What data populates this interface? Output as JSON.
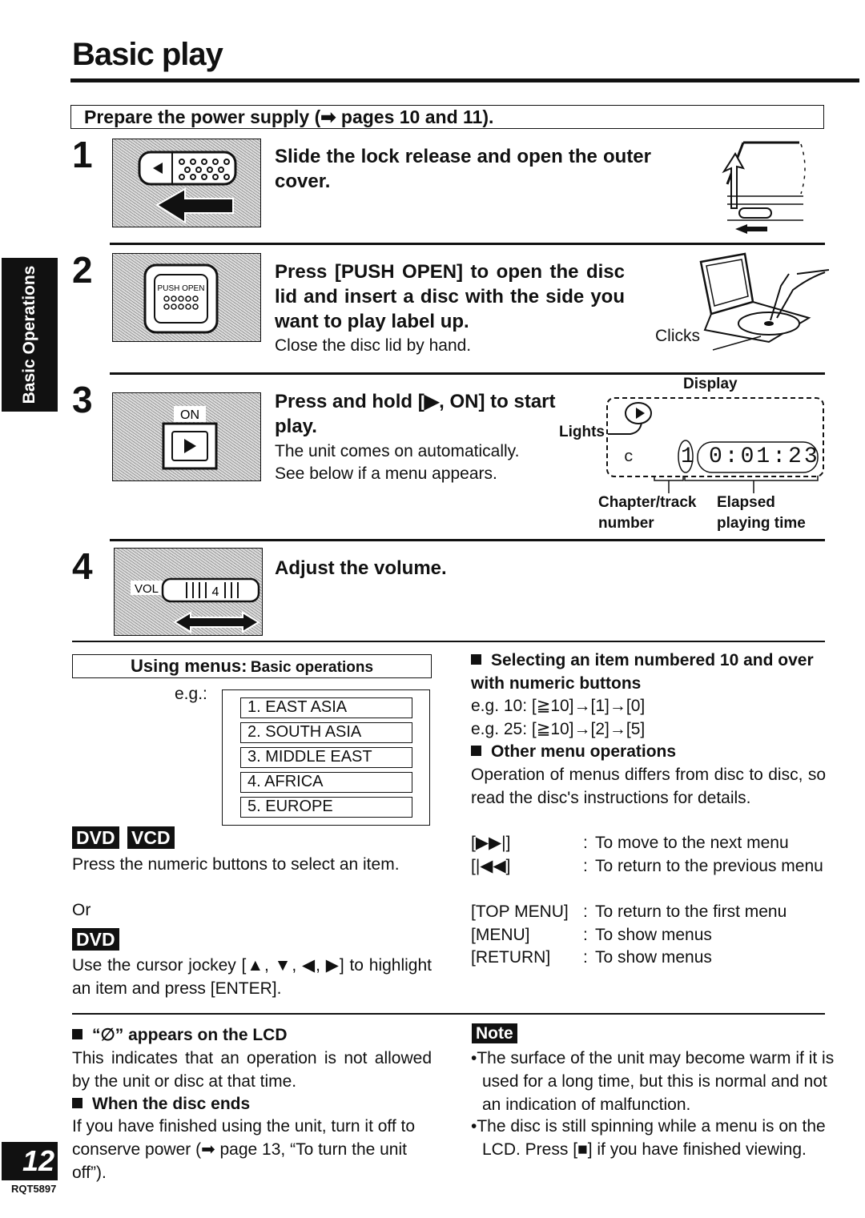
{
  "page": {
    "title": "Basic play",
    "side_tab": "Basic Operations",
    "page_number": "12",
    "doc_code": "RQT5897"
  },
  "prepare": {
    "text": "Prepare the power supply (➡ pages 10 and 11)."
  },
  "steps": [
    {
      "number": "1",
      "instruction": "Slide the lock release and open the outer cover.",
      "note": "",
      "photo_icon": "lock-release-slider-icon"
    },
    {
      "number": "2",
      "instruction": "Press [PUSH OPEN] to open the disc lid and insert a disc with the side you want to play label up.",
      "note": "Close the disc lid by hand.",
      "photo_label": "PUSH OPEN",
      "callout": "Clicks"
    },
    {
      "number": "3",
      "instruction": "Press and hold [▶, ON] to start play.",
      "note_lines": [
        "The unit comes on automatically.",
        "See below if a menu appears."
      ],
      "photo_label": "ON"
    },
    {
      "number": "4",
      "instruction": "Adjust the volume.",
      "photo_label": "VOL",
      "volume_value": "4"
    }
  ],
  "display": {
    "heading": "Display",
    "lights_label": "Lights",
    "chapter_value": "1",
    "time_value": "0:01:23",
    "left_indicator": "c",
    "chapter_label_line1": "Chapter/track",
    "chapter_label_line2": "number",
    "elapsed_label_line1": "Elapsed",
    "elapsed_label_line2": "playing time"
  },
  "menus": {
    "heading_main": "Using menus:",
    "heading_sub": "Basic operations",
    "eg_label": "e.g.:",
    "example_items": [
      "1. EAST ASIA",
      "2. SOUTH ASIA",
      "3. MIDDLE EAST",
      "4. AFRICA",
      "5. EUROPE"
    ],
    "badges_top": [
      "DVD",
      "VCD"
    ],
    "numeric_text": "Press the numeric buttons to select an item.",
    "or_text": "Or",
    "badge_dvd": "DVD",
    "cursor_text": "Use the cursor jockey [▲, ▼, ◀, ▶] to highlight an item and press [ENTER]."
  },
  "selecting": {
    "heading": "Selecting an item numbered 10 and over with numeric buttons",
    "example1": "e.g. 10: [≧10]→[1]→[0]",
    "example2": "e.g. 25: [≧10]→[2]→[5]"
  },
  "other_ops": {
    "heading": "Other menu operations",
    "text": "Operation of menus differs from disc to disc, so read the disc's instructions for details.",
    "rows": [
      {
        "key": "[▶▶|]",
        "value": "To move to the next menu"
      },
      {
        "key": "[|◀◀]",
        "value": "To return to the previous menu"
      },
      {
        "key": "[TOP MENU]",
        "value": "To return to the first menu"
      },
      {
        "key": "[MENU]",
        "value": "To show menus"
      },
      {
        "key": "[RETURN]",
        "value": "To show menus"
      }
    ]
  },
  "lcd_note": {
    "heading": "“⃠” appears on the LCD",
    "heading_symbol": "∅",
    "text": "This indicates that an operation is not allowed by the unit or disc at that time."
  },
  "disc_ends": {
    "heading": "When the disc ends",
    "text": "If you have finished using the unit, turn it off to conserve power (➡ page 13, “To turn the unit off”)."
  },
  "note": {
    "badge": "Note",
    "bullets": [
      "The surface of the unit may become warm if it is used for a long time, but this is normal and not an indication of malfunction.",
      "The disc is still spinning while a menu is on the LCD. Press [■] if you have finished viewing."
    ]
  }
}
